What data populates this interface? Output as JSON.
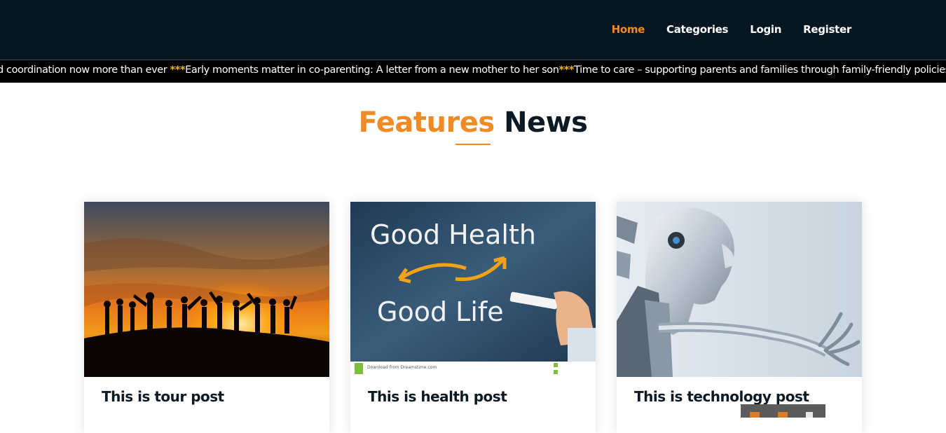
{
  "nav": {
    "items": [
      {
        "label": "Home",
        "active": true
      },
      {
        "label": "Categories",
        "active": false
      },
      {
        "label": "Login",
        "active": false
      },
      {
        "label": "Register",
        "active": false
      }
    ]
  },
  "ticker": {
    "items": [
      "d coordination now more than ever ",
      "Early moments matter in co-parenting: A letter from a new mother to her son",
      "Time to care – supporting parents and families through family-friendly policies"
    ],
    "separator": "***"
  },
  "section": {
    "title_accent": "Features",
    "title_rest": "News"
  },
  "cards": [
    {
      "title": "This is tour post",
      "image": "sunset-group-silhouette"
    },
    {
      "title": "This is health post",
      "image": "good-health-chalkboard"
    },
    {
      "title": "This is technology post",
      "image": "robot-figure"
    }
  ],
  "health_image_text": {
    "line1": "Good Health",
    "line2": "Good Life",
    "footer": "Download from Dreamstime.com"
  },
  "colors": {
    "topbar": "#061722",
    "accent": "#f08a24",
    "ticker_bg": "#000000",
    "separator": "#f5b400"
  }
}
